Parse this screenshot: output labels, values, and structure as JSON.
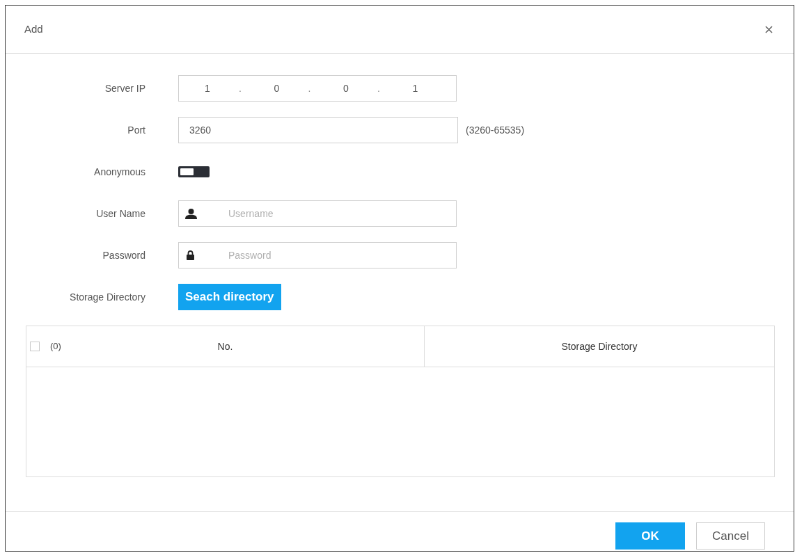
{
  "dialog": {
    "title": "Add"
  },
  "form": {
    "fields": [
      {
        "kind": "ip",
        "label": "Server IP",
        "octets": [
          "1",
          "0",
          "0",
          "1"
        ],
        "separators": [
          ".",
          ".",
          "."
        ]
      },
      {
        "kind": "text",
        "label": "Port",
        "value": "3260",
        "hint": "(3260-65535)"
      },
      {
        "kind": "toggle",
        "label": "Anonymous",
        "on": false
      },
      {
        "kind": "user",
        "label": "User Name",
        "placeholder": "Username"
      },
      {
        "kind": "password",
        "label": "Password",
        "placeholder": "Password"
      },
      {
        "kind": "action",
        "label": "Storage Directory",
        "button": "Seach directory"
      }
    ]
  },
  "table": {
    "select_all": {
      "checked": false
    },
    "count": "(0)",
    "columns": [
      "No.",
      "Storage Directory"
    ]
  },
  "buttons": [
    {
      "label": "OK",
      "kind": "primary"
    },
    {
      "label": "Cancel",
      "kind": "secondary"
    }
  ]
}
